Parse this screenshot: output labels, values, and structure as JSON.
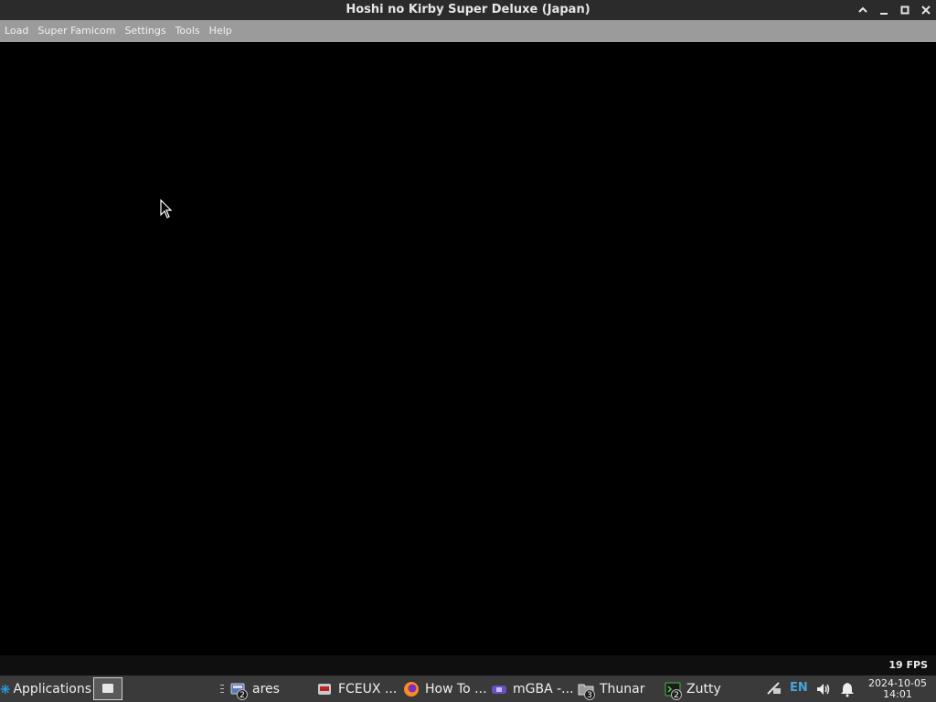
{
  "window": {
    "title": "Hoshi no Kirby Super Deluxe (Japan)"
  },
  "menu": {
    "items": [
      "Load",
      "Super Famicom",
      "Settings",
      "Tools",
      "Help"
    ]
  },
  "status": {
    "fps": "19 FPS"
  },
  "taskbar": {
    "applications_label": "Applications",
    "tasks": [
      {
        "label": "ares",
        "badge": "2",
        "icon": "ares-icon"
      },
      {
        "label": "FCEUX ...",
        "badge": "",
        "icon": "fceux-icon"
      },
      {
        "label": "How To ...",
        "badge": "",
        "icon": "firefox-icon"
      },
      {
        "label": "mGBA -...",
        "badge": "",
        "icon": "mgba-icon"
      },
      {
        "label": "Thunar",
        "badge": "3",
        "icon": "folder-icon"
      },
      {
        "label": "Zutty",
        "badge": "2",
        "icon": "terminal-icon"
      }
    ],
    "tray": {
      "lang": "EN",
      "date": "2024-10-05",
      "time": "14:01"
    }
  }
}
